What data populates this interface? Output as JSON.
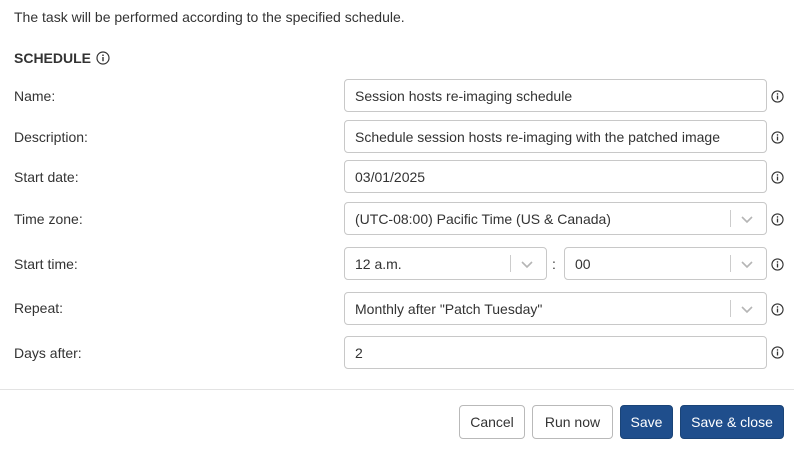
{
  "intro_text": "The task will be performed according to the specified schedule.",
  "section": {
    "title": "SCHEDULE"
  },
  "fields": {
    "name": {
      "label": "Name:",
      "value": "Session hosts re-imaging schedule"
    },
    "description": {
      "label": "Description:",
      "value": "Schedule session hosts re-imaging with the patched image"
    },
    "start_date": {
      "label": "Start date:",
      "value": "03/01/2025"
    },
    "time_zone": {
      "label": "Time zone:",
      "value": "(UTC-08:00) Pacific Time (US & Canada)"
    },
    "start_time": {
      "label": "Start time:",
      "hour": "12 a.m.",
      "separator": ":",
      "minute": "00"
    },
    "repeat": {
      "label": "Repeat:",
      "value": "Monthly after \"Patch Tuesday\""
    },
    "days_after": {
      "label": "Days after:",
      "value": "2"
    }
  },
  "buttons": {
    "cancel": "Cancel",
    "run_now": "Run now",
    "save": "Save",
    "save_close": "Save & close"
  },
  "icons": {
    "info": "info-circle-icon",
    "dropdown": "chevron-down-icon"
  },
  "colors": {
    "primary": "#1f4e8c",
    "border": "#c8c8c8",
    "text": "#333333"
  }
}
